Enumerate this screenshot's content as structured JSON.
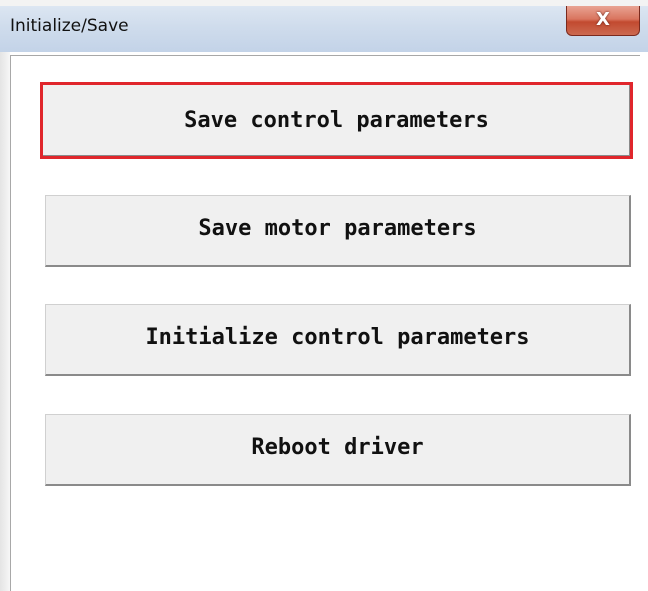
{
  "window": {
    "title": "Initialize/Save",
    "close_glyph": "X"
  },
  "buttons": {
    "save_control": "Save control parameters",
    "save_motor": "Save motor parameters",
    "init_control": "Initialize control parameters",
    "reboot": "Reboot driver"
  },
  "colors": {
    "focus_border": "#e0262c",
    "button_face": "#f0f0f0",
    "titlebar": "#cfdcec",
    "close_button": "#c24a30"
  },
  "icons": {
    "close": "close-icon"
  }
}
